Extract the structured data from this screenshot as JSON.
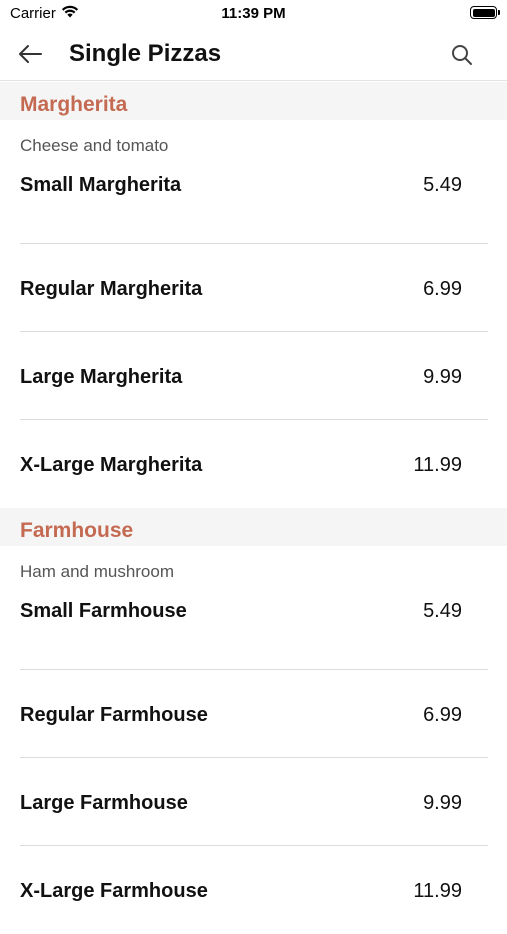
{
  "status_bar": {
    "carrier": "Carrier",
    "time": "11:39 PM"
  },
  "nav": {
    "title": "Single Pizzas",
    "back_icon": "arrow-left-icon",
    "search_icon": "search-icon"
  },
  "accent_color": "#c56a52",
  "sections": [
    {
      "title": "Margherita",
      "description": "Cheese and tomato",
      "items": [
        {
          "name": "Small Margherita",
          "price": "5.49"
        },
        {
          "name": "Regular Margherita",
          "price": "6.99"
        },
        {
          "name": "Large Margherita",
          "price": "9.99"
        },
        {
          "name": "X-Large Margherita",
          "price": "11.99"
        }
      ]
    },
    {
      "title": "Farmhouse",
      "description": "Ham and mushroom",
      "items": [
        {
          "name": "Small Farmhouse",
          "price": "5.49"
        },
        {
          "name": "Regular Farmhouse",
          "price": "6.99"
        },
        {
          "name": "Large Farmhouse",
          "price": "9.99"
        },
        {
          "name": "X-Large Farmhouse",
          "price": "11.99"
        }
      ]
    }
  ]
}
